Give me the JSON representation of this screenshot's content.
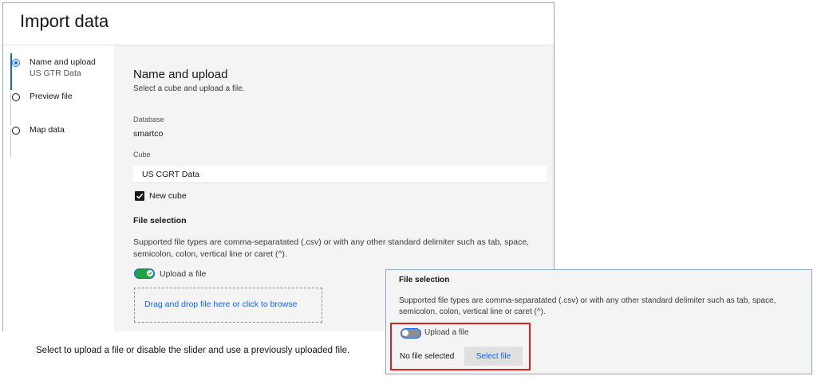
{
  "dialog": {
    "title": "Import data",
    "steps": [
      {
        "label": "Name and upload",
        "sub": "US GTR Data",
        "state": "current"
      },
      {
        "label": "Preview file",
        "state": "incomplete"
      },
      {
        "label": "Map data",
        "state": "incomplete"
      }
    ],
    "section": {
      "title": "Name and upload",
      "subtitle": "Select a cube and upload a file."
    },
    "database": {
      "label": "Database",
      "value": "smartco"
    },
    "cube": {
      "label": "Cube",
      "value": "US CGRT Data"
    },
    "new_cube": {
      "label": "New cube",
      "checked": true
    },
    "file_selection": {
      "heading": "File selection",
      "description": "Supported file types are comma-separatated (.csv) or with any other standard delimiter such as tab, space, semicolon, colon, vertical line or caret (^).",
      "toggle_label": "Upload a file",
      "toggle_on": true,
      "dropzone_text": "Drag and drop file here or click to browse"
    }
  },
  "caption": "Select to upload a file or disable the slider and use a previously uploaded file.",
  "inset": {
    "heading": "File selection",
    "description": "Supported file types are comma-separatated (.csv) or with any other standard delimiter such as tab, space, semicolon, colon, vertical line or caret (^).",
    "toggle_label": "Upload a file",
    "toggle_on": false,
    "no_file_text": "No file selected",
    "select_button": "Select file"
  },
  "colors": {
    "accent": "#0f62fe",
    "toggle_on": "#24a148",
    "highlight": "#da1e28"
  }
}
